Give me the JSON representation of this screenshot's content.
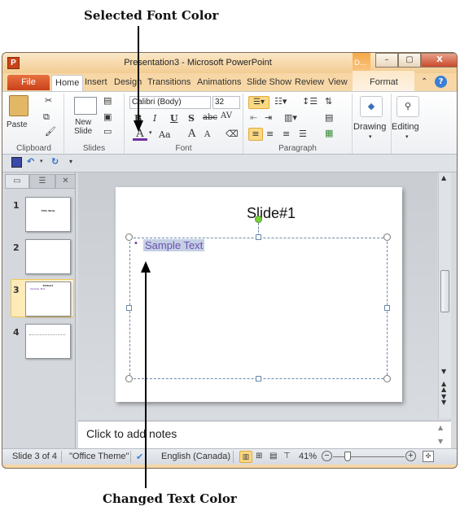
{
  "annotations": {
    "top": "Selected Font Color",
    "bottom": "Changed Text Color"
  },
  "window": {
    "title": "Presentation3 - Microsoft PowerPoint",
    "app_icon": "P",
    "context_tab_header": "D...",
    "minimize": "–",
    "maximize": "▢",
    "close": "X"
  },
  "tabs": [
    {
      "label": "File"
    },
    {
      "label": "Home"
    },
    {
      "label": "Insert"
    },
    {
      "label": "Design"
    },
    {
      "label": "Transitions"
    },
    {
      "label": "Animations"
    },
    {
      "label": "Slide Show"
    },
    {
      "label": "Review"
    },
    {
      "label": "View"
    },
    {
      "label": "Format"
    }
  ],
  "ribbon": {
    "clipboard": {
      "label": "Clipboard",
      "paste": "Paste"
    },
    "slides": {
      "label": "Slides",
      "new_slide": "New",
      "new_slide2": "Slide"
    },
    "font": {
      "label": "Font",
      "font_name": "Calibri (Body)",
      "font_size": "32",
      "bold": "B",
      "italic": "I",
      "underline": "U",
      "shadow": "S",
      "strikethrough": "abc",
      "spacing": "AV",
      "font_color_glyph": "A",
      "change_case": "Aa",
      "grow": "A",
      "shrink": "A",
      "selected_font_color": "#7030a0"
    },
    "paragraph": {
      "label": "Paragraph"
    },
    "drawing": {
      "label": "Drawing"
    },
    "editing": {
      "label": "Editing"
    }
  },
  "slides_pane": {
    "thumbnails": [
      {
        "number": "1",
        "text": "Title Slide"
      },
      {
        "number": "2",
        "text": ""
      },
      {
        "number": "3",
        "text": "Slide#1",
        "sub": "Sample Text",
        "selected": true
      },
      {
        "number": "4",
        "text": ""
      }
    ]
  },
  "slide": {
    "title": "Slide#1",
    "body_text": "Sample Text",
    "body_color": "#7a5fb5",
    "bullet": "•"
  },
  "notes": {
    "placeholder": "Click to add notes"
  },
  "status_bar": {
    "slide_info": "Slide 3 of 4",
    "theme": "\"Office Theme\"",
    "language": "English (Canada)",
    "zoom": "41%",
    "zoom_level_percent": 41
  }
}
